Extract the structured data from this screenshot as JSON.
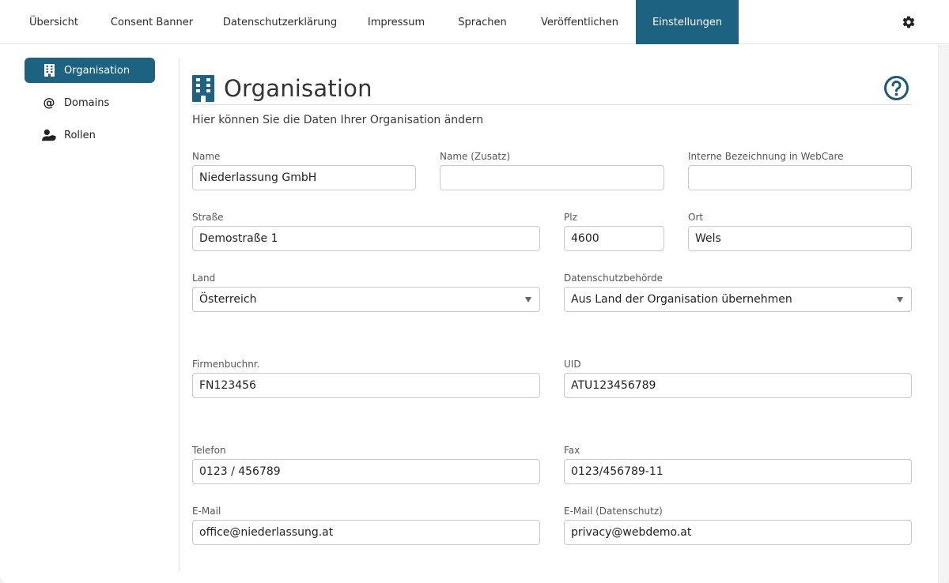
{
  "nav": {
    "tabs": [
      {
        "label": "Übersicht"
      },
      {
        "label": "Consent Banner"
      },
      {
        "label": "Datenschutzerklärung"
      },
      {
        "label": "Impressum"
      },
      {
        "label": "Sprachen"
      },
      {
        "label": "Veröffentlichen"
      },
      {
        "label": "Einstellungen",
        "active": true
      }
    ],
    "settings_icon": "gear-icon"
  },
  "sidebar": {
    "items": [
      {
        "label": "Organisation",
        "icon": "building-icon",
        "active": true
      },
      {
        "label": "Domains",
        "icon": "at-icon"
      },
      {
        "label": "Rollen",
        "icon": "user-shield-icon"
      }
    ]
  },
  "main": {
    "title": "Organisation",
    "title_icon": "building-icon",
    "help_icon": "help-circle-icon",
    "subtitle": "Hier können Sie die Daten Ihrer Organisation ändern",
    "fields": {
      "name": {
        "label": "Name",
        "value": "Niederlassung GmbH"
      },
      "name_extra": {
        "label": "Name (Zusatz)",
        "value": ""
      },
      "internal_name": {
        "label": "Interne Bezeichnung in WebCare",
        "value": ""
      },
      "street": {
        "label": "Straße",
        "value": "Demostraße 1"
      },
      "zip": {
        "label": "Plz",
        "value": "4600"
      },
      "city": {
        "label": "Ort",
        "value": "Wels"
      },
      "country": {
        "label": "Land",
        "value": "Österreich"
      },
      "authority": {
        "label": "Datenschutzbehörde",
        "value": "Aus Land der Organisation übernehmen"
      },
      "register_no": {
        "label": "Firmenbuchnr.",
        "value": "FN123456"
      },
      "uid": {
        "label": "UID",
        "value": "ATU123456789"
      },
      "phone": {
        "label": "Telefon",
        "value": "0123 / 456789"
      },
      "fax": {
        "label": "Fax",
        "value": "0123/456789-11"
      },
      "email": {
        "label": "E-Mail",
        "value": "office@niederlassung.at"
      },
      "email_privacy": {
        "label": "E-Mail (Datenschutz)",
        "value": "privacy@webdemo.at"
      }
    }
  },
  "colors": {
    "accent": "#1d6280",
    "help_icon": "#1f5a70"
  }
}
